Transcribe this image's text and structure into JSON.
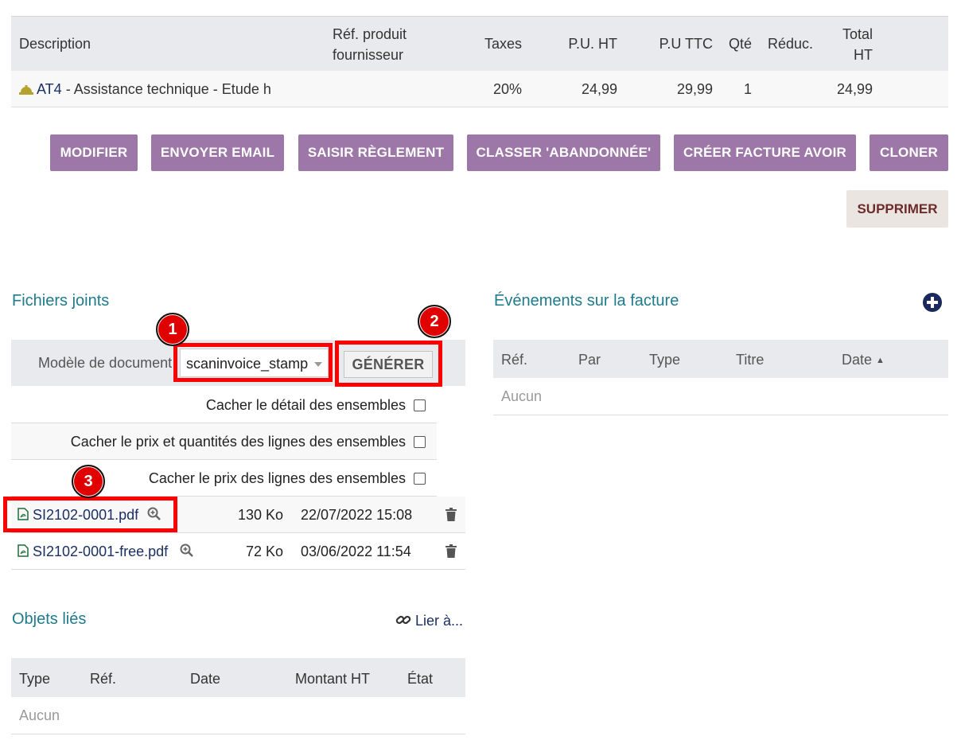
{
  "lines": {
    "headers": {
      "description": "Description",
      "ref": "Réf. produit fournisseur",
      "taxes": "Taxes",
      "pu_ht": "P.U. HT",
      "pu_ttc": "P.U TTC",
      "qty": "Qté",
      "discount": "Réduc.",
      "total_ht": "Total HT"
    },
    "row": {
      "icon": "service-bell-icon",
      "code": "AT4",
      "label": " - Assistance technique - Etude h",
      "tax": "20%",
      "pu_ht": "24,99",
      "pu_ttc": "29,99",
      "qty": "1",
      "total_ht": "24,99"
    }
  },
  "actions": {
    "modify": "MODIFIER",
    "send_email": "ENVOYER EMAIL",
    "payment": "SAISIR RÈGLEMENT",
    "classify": "CLASSER 'ABANDONNÉE'",
    "credit_note": "CRÉER FACTURE AVOIR",
    "clone": "CLONER",
    "delete": "SUPPRIMER"
  },
  "files": {
    "title": "Fichiers joints",
    "model_label": "Modèle de document",
    "model_value": "scaninvoice_stamp",
    "generate": "GÉNÉRER",
    "options": [
      "Cacher le détail des ensembles",
      "Cacher le prix et quantités des lignes des ensembles",
      "Cacher le prix des lignes des ensembles"
    ],
    "items": [
      {
        "name": "SI2102-0001.pdf",
        "size": "130 Ko",
        "date": "22/07/2022 15:08"
      },
      {
        "name": "SI2102-0001-free.pdf",
        "size": "72 Ko",
        "date": "03/06/2022 11:54"
      }
    ]
  },
  "annotations": [
    "1",
    "2",
    "3"
  ],
  "events": {
    "title": "Événements sur la facture",
    "headers": [
      "Réf.",
      "Par",
      "Type",
      "Titre",
      "Date"
    ],
    "empty": "Aucun"
  },
  "linked": {
    "title": "Objets liés",
    "link_label": "Lier à...",
    "headers": [
      "Type",
      "Réf.",
      "Date",
      "Montant HT",
      "État"
    ],
    "empty": "Aucun"
  },
  "colors": {
    "action_button": "#9c77a8",
    "section_title": "#1e7b8c",
    "highlight": "#ff0000"
  }
}
